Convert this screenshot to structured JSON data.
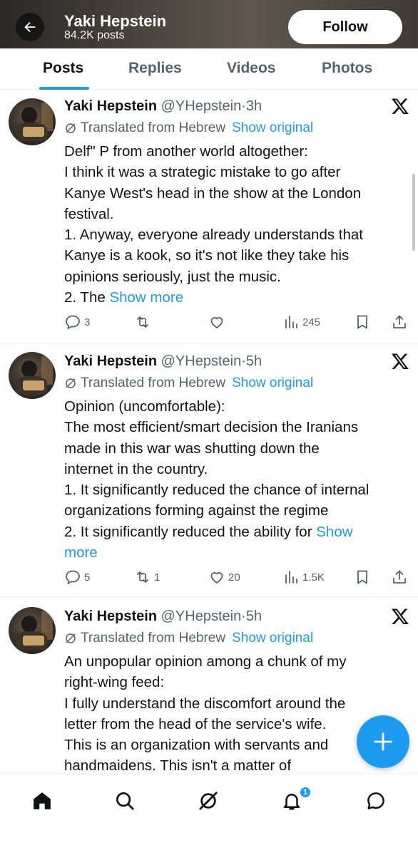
{
  "header": {
    "title": "Yaki Hepstein",
    "subtitle": "84.2K posts",
    "follow_label": "Follow"
  },
  "tabs": [
    {
      "label": "Posts",
      "active": true
    },
    {
      "label": "Replies",
      "active": false
    },
    {
      "label": "Videos",
      "active": false
    },
    {
      "label": "Photos",
      "active": false
    }
  ],
  "posts": [
    {
      "name": "Yaki Hepstein",
      "handle": "@YHepstein",
      "time": "3h",
      "translated": "Translated from Hebrew",
      "show_original": "Show original",
      "lines": [
        "Delf\" P from another world altogether:",
        "I think it was a strategic mistake to go after",
        "Kanye West's head in the show at the London",
        "festival.",
        "1. Anyway, everyone already understands that",
        "Kanye is a kook, so it's not like they take his",
        "opinions seriously, just the music.",
        "2. The"
      ],
      "show_more": "Show more",
      "replies": "3",
      "reposts": "",
      "likes": "",
      "views": "245"
    },
    {
      "name": "Yaki Hepstein",
      "handle": "@YHepstein",
      "time": "5h",
      "translated": "Translated from Hebrew",
      "show_original": "Show original",
      "lines": [
        "Opinion (uncomfortable):",
        "The most efficient/smart decision the Iranians",
        "made in this war was shutting down the",
        "internet in the country.",
        "1. It significantly reduced the chance of internal",
        "organizations forming against the regime",
        "2. It significantly reduced the ability for"
      ],
      "show_more_a": "Show",
      "show_more_b": "more",
      "replies": "5",
      "reposts": "1",
      "likes": "20",
      "views": "1.5K"
    },
    {
      "name": "Yaki Hepstein",
      "handle": "@YHepstein",
      "time": "5h",
      "translated": "Translated from Hebrew",
      "show_original": "Show original",
      "lines": [
        "An unpopular opinion among a chunk of my",
        "right-wing feed:",
        "I fully understand the discomfort around the",
        "letter from the head of the service's wife.",
        "This is an organization with servants and",
        "handmaidens. This isn't a matter of"
      ]
    }
  ],
  "notifications_badge": "1",
  "colors": {
    "accent": "#1d9bf0",
    "text": "#0f1419",
    "secondary": "#536471"
  }
}
